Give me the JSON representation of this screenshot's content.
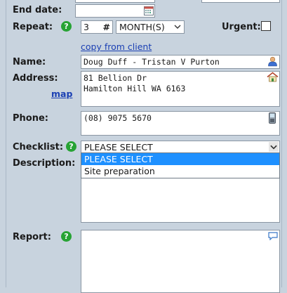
{
  "form": {
    "end_date": {
      "label": "End date:",
      "value": ""
    },
    "repeat": {
      "label": "Repeat:",
      "count": "3",
      "hash_label": "#",
      "unit_selected": "MONTH(S)"
    },
    "urgent": {
      "label": "Urgent:",
      "checked": false
    },
    "copy_link": "copy from client",
    "name": {
      "label": "Name:",
      "value": "Doug Duff - Tristan V Purton"
    },
    "address": {
      "label": "Address:",
      "map_link": "map",
      "line1": "81 Bellion Dr",
      "line2": "Hamilton Hill WA 6163"
    },
    "phone": {
      "label": "Phone:",
      "value": "(08) 9075 5670"
    },
    "checklist": {
      "label": "Checklist:",
      "selected": "PLEASE SELECT",
      "options": [
        "PLEASE SELECT",
        "Site preparation"
      ]
    },
    "description": {
      "label": "Description:",
      "value": ""
    },
    "report": {
      "label": "Report:",
      "value": ""
    }
  },
  "icons": {
    "help": "help-icon",
    "calendar": "calendar-icon",
    "person": "person-icon",
    "house": "house-icon",
    "phone": "phone-icon",
    "comment": "comment-icon",
    "chevron": "chevron-down-icon"
  },
  "colors": {
    "panel_bg": "#c8d3de",
    "help_green": "#27a334",
    "link_blue": "#1a3fb3",
    "selected_option": "#1e90ff"
  }
}
